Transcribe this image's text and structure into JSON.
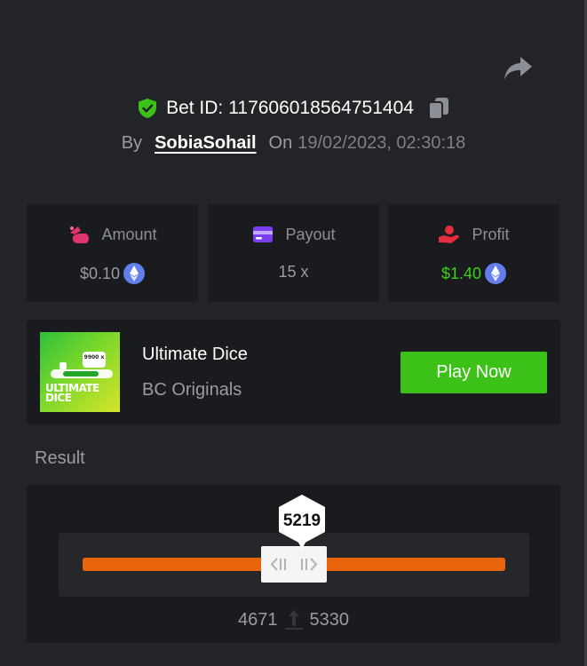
{
  "header": {
    "bet_id_label": "Bet ID:",
    "bet_id": "117606018564751404",
    "by_label": "By",
    "username": "SobiaSohail",
    "on_label": "On",
    "datetime": "19/02/2023, 02:30:18"
  },
  "stats": [
    {
      "label": "Amount",
      "value": "$0.10",
      "icon": "money-bag-icon",
      "currency_icon": "ethereum-icon"
    },
    {
      "label": "Payout",
      "value": "15 x",
      "icon": "wallet-card-icon"
    },
    {
      "label": "Profit",
      "value": "$1.40",
      "icon": "hand-coin-icon",
      "currency_icon": "ethereum-icon"
    }
  ],
  "game": {
    "title": "Ultimate Dice",
    "provider": "BC Originals",
    "play_label": "Play Now",
    "thumb_text": "ULTIMATE DICE",
    "thumb_chip": "9900 x"
  },
  "result": {
    "label": "Result",
    "roll": "5219",
    "range_low": "4671",
    "range_high": "5330"
  },
  "colors": {
    "background": "#232427",
    "card": "#1a1b1e",
    "accent_green": "#3bc117",
    "profit_green": "#3ed016",
    "bar_orange": "#e8650c",
    "ethereum_blue": "#627eea"
  }
}
